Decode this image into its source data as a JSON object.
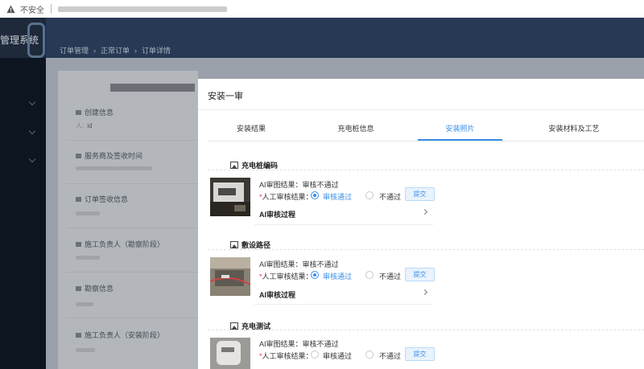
{
  "browser": {
    "security_label": "不安全",
    "warning_icon": "warning-triangle-icon"
  },
  "app": {
    "title": "管理系统"
  },
  "breadcrumb": [
    "订单管理",
    "正常订单",
    "订单详情"
  ],
  "detail_sections": [
    {
      "label": "创建信息",
      "sub": "id"
    },
    {
      "label": "服务商及签收时间"
    },
    {
      "label": "订单签收信息"
    },
    {
      "label": "施工负责人（勘察阶段）"
    },
    {
      "label": "勘察信息"
    },
    {
      "label": "施工负责人（安装阶段）"
    }
  ],
  "modal": {
    "title": "安装一审",
    "tabs": [
      {
        "label": "安装结果",
        "active": false
      },
      {
        "label": "充电桩信息",
        "active": false
      },
      {
        "label": "安装照片",
        "active": true
      },
      {
        "label": "安装材料及工艺",
        "active": false
      }
    ],
    "photo_sections": [
      {
        "title": "充电桩编码",
        "ai_result": "AI审图结果：审核不通过",
        "manual_label": "人工审核结果：",
        "pass_label": "审核通过",
        "fail_label": "不通过",
        "selected": "pass",
        "submit_label": "提交",
        "process_label": "AI审核过程"
      },
      {
        "title": "敷设路径",
        "ai_result": "AI审图结果：审核不通过",
        "manual_label": "人工审核结果：",
        "pass_label": "审核通过",
        "fail_label": "不通过",
        "selected": "pass",
        "submit_label": "提交",
        "process_label": "AI审核过程"
      },
      {
        "title": "充电测试",
        "ai_result": "AI审图结果：审核不通过",
        "manual_label": "人工审核结果：",
        "pass_label": "审核通过",
        "fail_label": "不通过",
        "selected": "none",
        "submit_label": "提交"
      }
    ]
  },
  "colors": {
    "accent": "#3a8ee6",
    "header": "#273954",
    "sidebar": "#0d1520",
    "required": "#e4393c"
  }
}
